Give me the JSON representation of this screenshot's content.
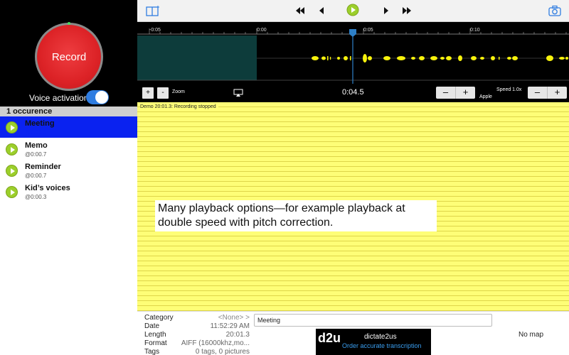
{
  "left_panel": {
    "record_label": "Record",
    "voice_activation_label": "Voice activation",
    "occurrence_header": "1 occurence",
    "recordings": [
      {
        "name": "Meeting",
        "time": "@0:00.1",
        "selected": true
      },
      {
        "name": "Memo",
        "time": "@0:00.7",
        "selected": false
      },
      {
        "name": "Reminder",
        "time": "@0:00.7",
        "selected": false
      },
      {
        "name": "Kid’s voices",
        "time": "@0:00.3",
        "selected": false
      }
    ]
  },
  "timeline": {
    "ticks": [
      "-0:05",
      "0:00",
      "0:05",
      "0:10"
    ]
  },
  "controls": {
    "zoom_in_label": "+",
    "zoom_out_label": "-",
    "zoom_label": "Zoom",
    "time": "0:04.5",
    "minus_label": "–",
    "plus_label": "+",
    "apple_label": "Apple",
    "speed_label": "Speed 1.0x"
  },
  "notes": {
    "status": "Demo 20:01.3: Recording stopped",
    "caption_line1": "Many playback options—for example playback at",
    "caption_line2": "double speed with pitch correction."
  },
  "metadata": {
    "category_key": "Category",
    "category_value": "<None>  >",
    "date_key": "Date",
    "date_value": "11:52:29 AM",
    "length_key": "Length",
    "length_value": "20:01.3",
    "format_key": "Format",
    "format_value": "AIFF (16000khz,mo...",
    "tags_key": "Tags",
    "tags_value": "0 tags, 0 pictures"
  },
  "category_field_value": "Meeting",
  "ad": {
    "logo": "d2u",
    "title": "dictate2us",
    "subtitle": "Order accurate transcription"
  },
  "map_label": "No map",
  "colors": {
    "record_red": "#dc2226",
    "selection_blue": "#0a22f0",
    "toggle_blue": "#2f7de1",
    "notes_yellow": "#fefe77",
    "waveform_yellow": "#f7f20c",
    "playhead_blue": "#2e80c8",
    "play_green": "#9ccf2b"
  },
  "icons": [
    "split-view-icon",
    "skip-to-start-icon",
    "step-back-icon",
    "play-icon",
    "step-forward-icon",
    "skip-to-end-icon",
    "camera-icon",
    "airplay-icon"
  ]
}
